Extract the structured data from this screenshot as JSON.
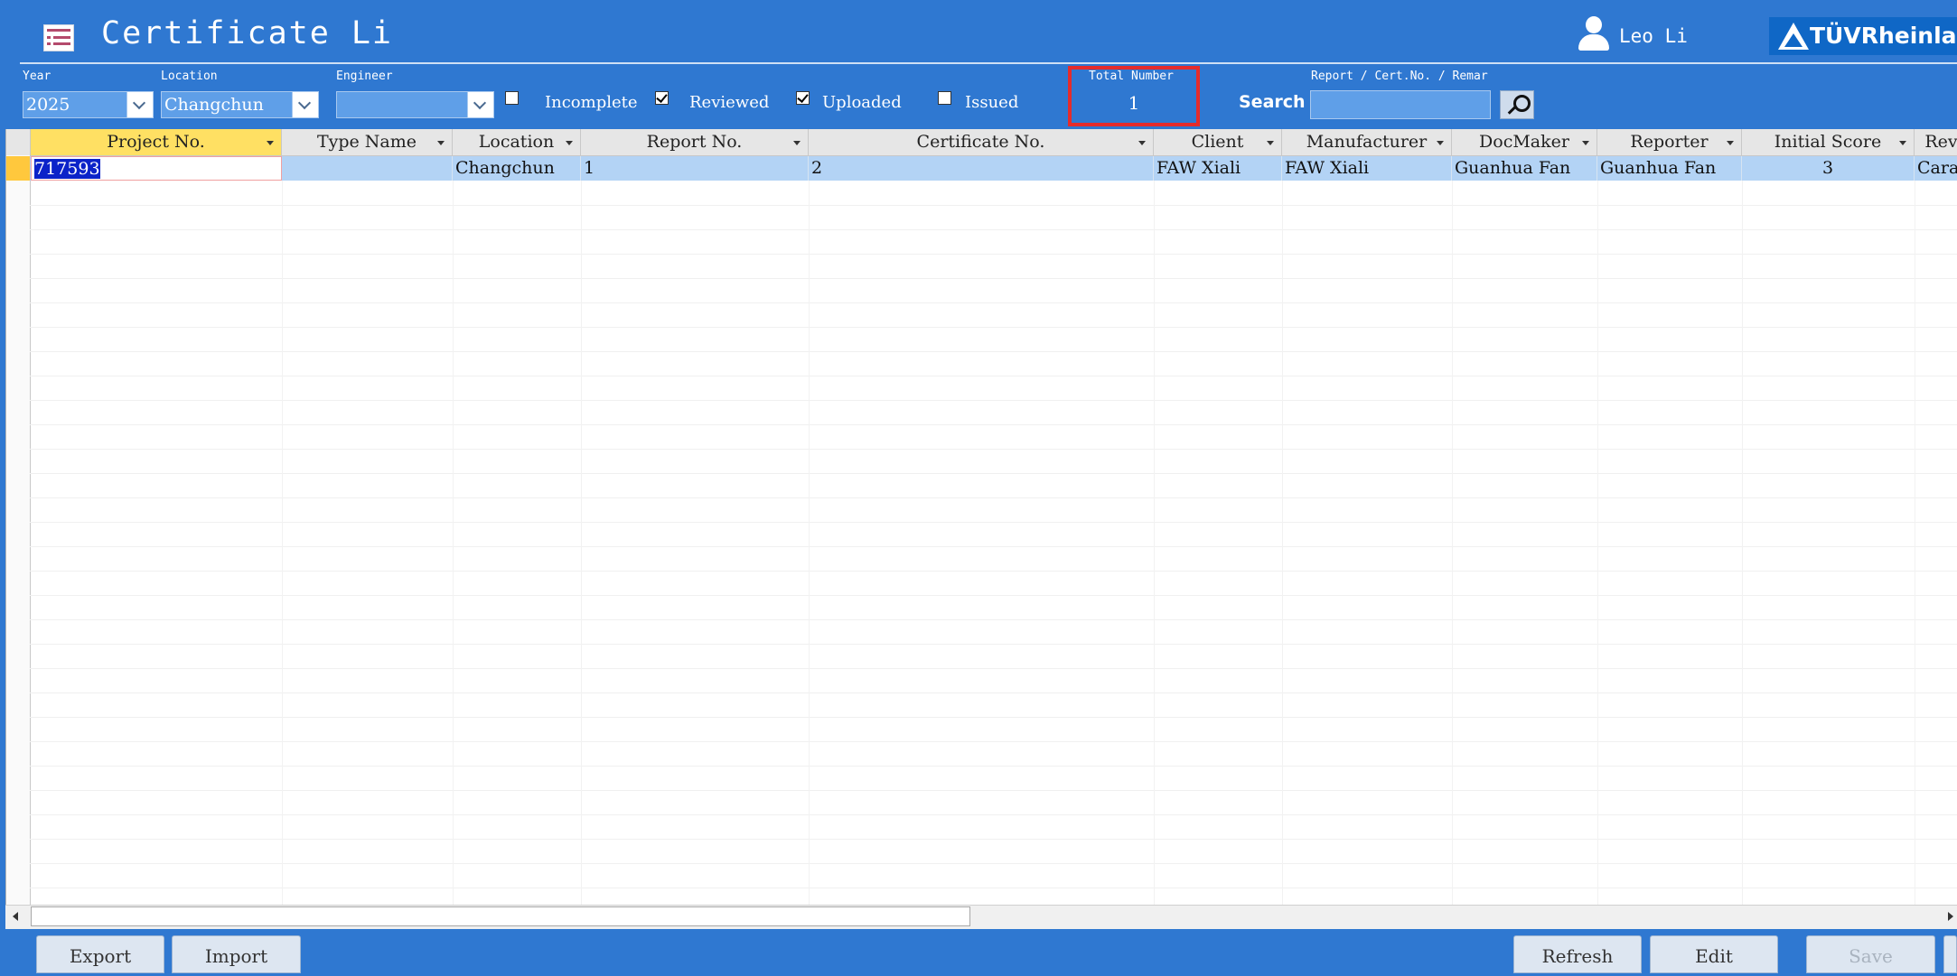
{
  "header": {
    "title": "Certificate Li",
    "user_name": "Leo Li",
    "logo_text": "TÜVRheinland"
  },
  "filters": {
    "year": {
      "label": "Year",
      "value": "2025"
    },
    "location": {
      "label": "Location",
      "value": "Changchun"
    },
    "engineer": {
      "label": "Engineer",
      "value": ""
    },
    "checkboxes": [
      {
        "label": "Incomplete",
        "checked": false
      },
      {
        "label": "Reviewed",
        "checked": true
      },
      {
        "label": "Uploaded",
        "checked": true
      },
      {
        "label": "Issued",
        "checked": false
      }
    ],
    "total": {
      "label": "Total Number",
      "value": "1"
    },
    "search": {
      "label": "Search",
      "field_label": "Report / Cert.No. / Remar",
      "value": ""
    }
  },
  "grid": {
    "columns": [
      "Project No.",
      "Type Name",
      "Location",
      "Report No.",
      "Certificate No.",
      "Client",
      "Manufacturer",
      "DocMaker",
      "Reporter",
      "Initial Score",
      "Rev"
    ],
    "rows": [
      [
        "717593",
        "",
        "Changchun",
        "1",
        "2",
        "FAW Xiali",
        "FAW Xiali",
        "Guanhua Fan",
        "Guanhua Fan",
        "3",
        "Cara"
      ]
    ]
  },
  "footer": {
    "export": "Export",
    "import": "Import",
    "refresh": "Refresh",
    "edit": "Edit",
    "save": "Save"
  },
  "colors": {
    "background": "#2f78d1",
    "row_selected": "#b3d3f5",
    "active_header": "#ffe063",
    "total_highlight": "#e52b2b"
  }
}
